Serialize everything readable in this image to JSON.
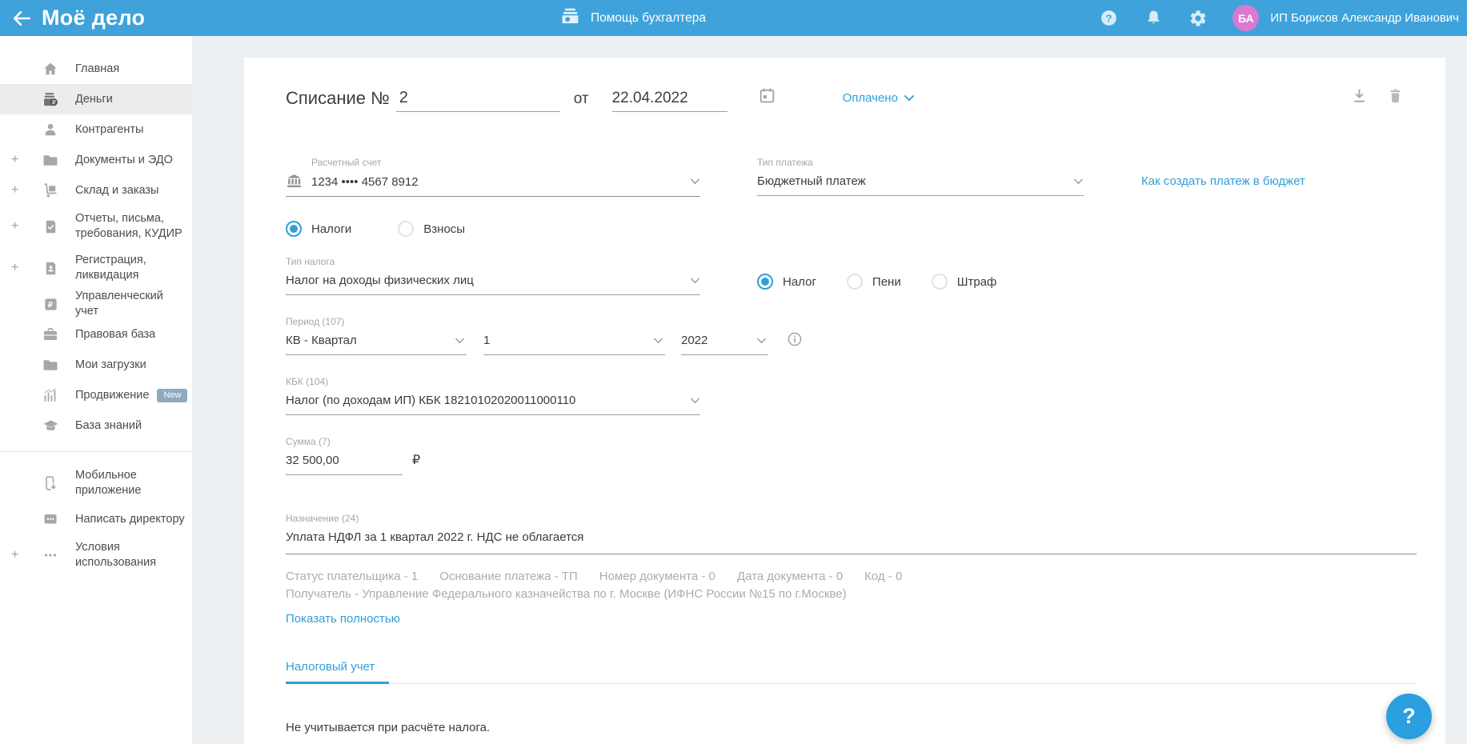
{
  "header": {
    "logo": "Моё дело",
    "helper_label": "Помощь бухгалтера",
    "user_name": "ИП Борисов Александр Иванович",
    "avatar_initials": "БА"
  },
  "sidebar": {
    "items": [
      {
        "label": "Главная",
        "icon": "home"
      },
      {
        "label": "Деньги",
        "icon": "money",
        "active": true
      },
      {
        "label": "Контрагенты",
        "icon": "person"
      },
      {
        "label": "Документы и ЭДО",
        "icon": "folder",
        "plus": "+"
      },
      {
        "label": "Склад и заказы",
        "icon": "trolley",
        "plus": "+"
      },
      {
        "label": "Отчеты, письма,\nтребования, КУДИР",
        "icon": "doc-check",
        "plus": "+"
      },
      {
        "label": "Регистрация,\nликвидация",
        "icon": "doc-person",
        "plus": "+"
      },
      {
        "label": "Управленческий учет",
        "icon": "ruble-doc"
      },
      {
        "label": "Правовая база",
        "icon": "briefcase"
      },
      {
        "label": "Мои загрузки",
        "icon": "folder"
      },
      {
        "label": "Продвижение",
        "icon": "promo",
        "badge": "New"
      },
      {
        "label": "База знаний",
        "icon": "grad-cap"
      }
    ],
    "footer_items": [
      {
        "label": "Мобильное\nприложение",
        "icon": "phone"
      },
      {
        "label": "Написать директору",
        "icon": "chat"
      },
      {
        "label": "Условия\nиспользования",
        "icon": "dots",
        "plus": "+"
      }
    ]
  },
  "document": {
    "title": "Списание №",
    "number": "2",
    "date_label": "от",
    "date": "22.04.2022",
    "status": "Оплачено"
  },
  "form": {
    "account": {
      "label": "Расчетный счет",
      "value": "1234 •••• 4567 8912"
    },
    "payment_type": {
      "label": "Тип платежа",
      "value": "Бюджетный платеж"
    },
    "budget_link": "Как создать платеж в бюджет",
    "category": {
      "options": [
        {
          "label": "Налоги",
          "selected": true
        },
        {
          "label": "Взносы",
          "selected": false
        }
      ]
    },
    "tax_type": {
      "label": "Тип налога",
      "value": "Налог на доходы физических лиц"
    },
    "payment_kind": {
      "options": [
        {
          "label": "Налог",
          "selected": true
        },
        {
          "label": "Пени",
          "selected": false
        },
        {
          "label": "Штраф",
          "selected": false
        }
      ]
    },
    "period": {
      "label": "Период (107)",
      "quarter": "КВ - Квартал",
      "number": "1",
      "year": "2022"
    },
    "kbk": {
      "label": "КБК (104)",
      "value": "Налог (по доходам ИП) КБК 18210102020011000110"
    },
    "amount": {
      "label": "Сумма (7)",
      "value": "32 500,00",
      "currency": "₽"
    },
    "purpose": {
      "label": "Назначение (24)",
      "value": "Уплата НДФЛ за 1 квартал 2022 г. НДС не облагается"
    },
    "details": {
      "parts": [
        "Статус плательщика - 1",
        "Основание платежа - ТП",
        "Номер документа - 0",
        "Дата документа - 0",
        "Код - 0"
      ],
      "recipient": "Получатель - Управление Федерального казначейства по г. Москве (ИФНС России №15 по г.Москве)",
      "show_more": "Показать полностью"
    },
    "tab": "Налоговый учет",
    "tax_note": "Не учитывается при расчёте налога."
  },
  "fab": {
    "glyph": "?"
  },
  "colors": {
    "accent": "#2f9fd8",
    "header": "#3fa2da",
    "avatar": "#d97ad2"
  }
}
